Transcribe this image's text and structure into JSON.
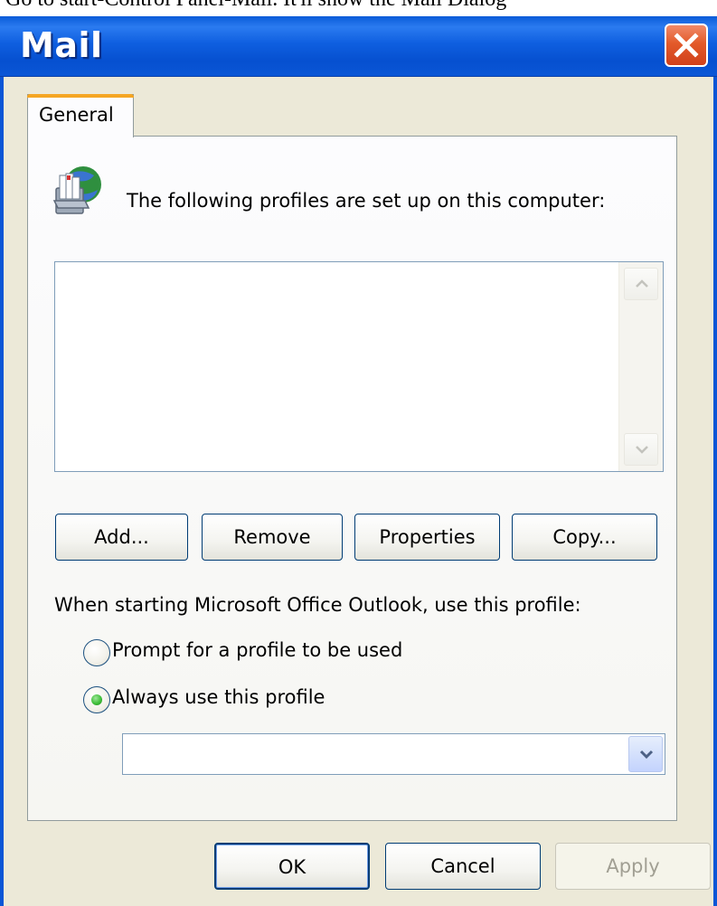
{
  "top_caption": "Go to start-Control Panel-Mail. It'll show the Mail Dialog",
  "window": {
    "title": "Mail",
    "close_icon": "close-icon"
  },
  "tabs": [
    {
      "label": "General",
      "selected": true
    }
  ],
  "general": {
    "profiles_label": "The following profiles are set up on this computer:",
    "profile_list": [],
    "buttons": {
      "add": "Add...",
      "remove": "Remove",
      "properties": "Properties",
      "copy": "Copy..."
    },
    "startup_label": "When starting Microsoft Office Outlook, use this profile:",
    "options": {
      "prompt": "Prompt for a profile to be used",
      "always": "Always use this profile"
    },
    "selected_option": "always",
    "profile_select_value": ""
  },
  "footer": {
    "ok": "OK",
    "cancel": "Cancel",
    "apply": "Apply",
    "apply_enabled": false
  },
  "colors": {
    "titlebar": "#0a56d6",
    "dialog_bg": "#ece9d8",
    "tab_highlight": "#f5a623",
    "close_button": "#e35a2a",
    "radio_selected": "#3fbf3a"
  }
}
